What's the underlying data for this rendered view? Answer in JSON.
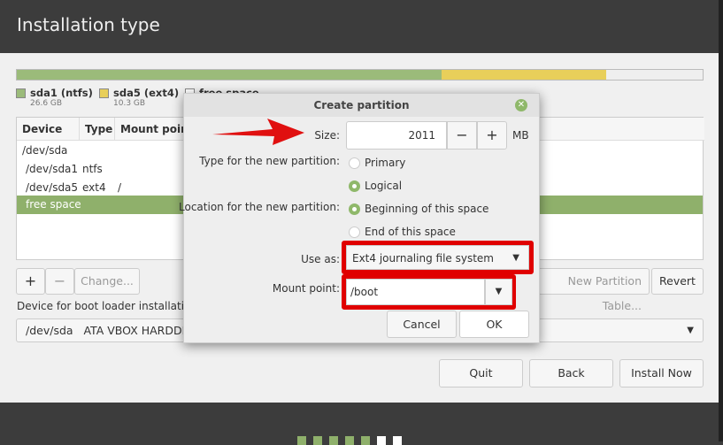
{
  "title": "Installation type",
  "partition_bar": {
    "segments": [
      {
        "name": "sda1 (ntfs)",
        "size": "26.6 GB",
        "color": "#9bbb7a",
        "fraction": 0.619
      },
      {
        "name": "sda5 (ext4)",
        "size": "10.3 GB",
        "color": "#e8cf5a",
        "fraction": 0.241
      },
      {
        "name": "free space",
        "color": "#efefef",
        "fraction": 0.14
      }
    ]
  },
  "table": {
    "headers": [
      "Device",
      "Type",
      "Mount point"
    ],
    "rows": [
      [
        "/dev/sda",
        "",
        ""
      ],
      [
        "/dev/sda1",
        "ntfs",
        ""
      ],
      [
        "/dev/sda5",
        "ext4",
        "/"
      ],
      [
        "free space",
        "",
        ""
      ]
    ]
  },
  "table_buttons": {
    "add": "+",
    "remove": "−",
    "change": "Change...",
    "new_table": "New Partition Table...",
    "revert": "Revert"
  },
  "boot_loader": {
    "label": "Device for boot loader installation:",
    "value": "/dev/sda   ATA VBOX HARDDISK"
  },
  "nav": {
    "quit": "Quit",
    "back": "Back",
    "install": "Install Now"
  },
  "dialog": {
    "title": "Create partition",
    "size_label": "Size:",
    "size_value": "2011",
    "minus": "−",
    "plus": "+",
    "unit": "MB",
    "type_label": "Type for the new partition:",
    "type_options": [
      "Primary",
      "Logical"
    ],
    "type_selected": "Logical",
    "location_label": "Location for the new partition:",
    "location_options": [
      "Beginning of this space",
      "End of this space"
    ],
    "location_selected": "Beginning of this space",
    "use_as_label": "Use as:",
    "use_as_value": "Ext4 journaling file system",
    "mount_label": "Mount point:",
    "mount_value": "/boot",
    "cancel": "Cancel",
    "ok": "OK"
  },
  "progress": {
    "total": 7,
    "completed": 5
  }
}
